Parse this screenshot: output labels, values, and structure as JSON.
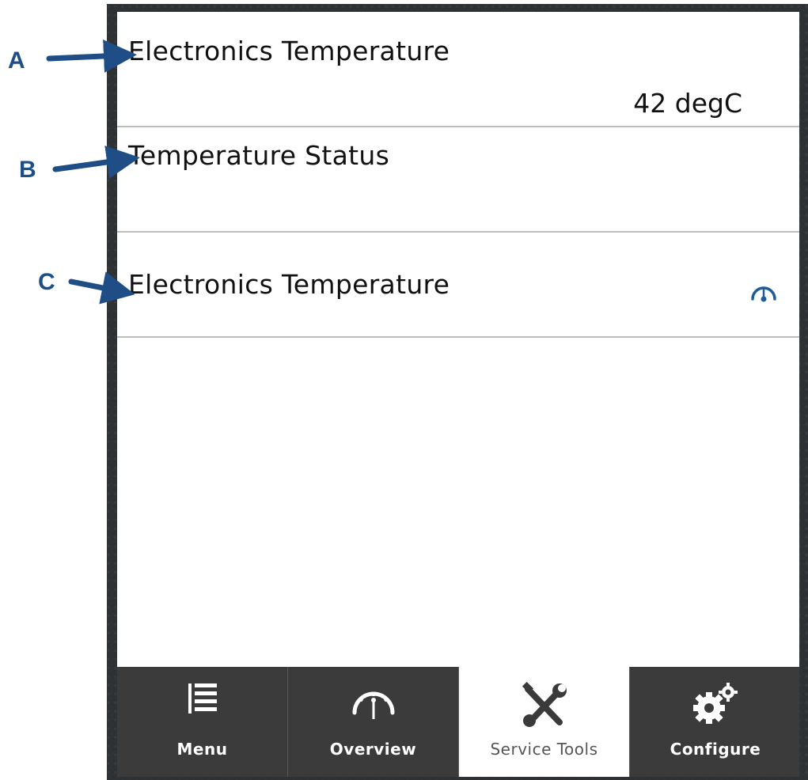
{
  "rows": [
    {
      "label": "Electronics Temperature",
      "value": "42 degC"
    },
    {
      "label": "Temperature Status"
    },
    {
      "label": "Electronics Temperature",
      "icon": "gauge-icon"
    }
  ],
  "callouts": {
    "a": "A",
    "b": "B",
    "c": "C"
  },
  "tabs": [
    {
      "label": "Menu",
      "icon": "menu-list-icon",
      "active": false
    },
    {
      "label": "Overview",
      "icon": "gauge-icon",
      "active": false
    },
    {
      "label": "Service Tools",
      "icon": "tools-icon",
      "active": true
    },
    {
      "label": "Configure",
      "icon": "gears-icon",
      "active": false
    }
  ],
  "colors": {
    "callout": "#1f4e86",
    "tabbar": "#3b3b3b",
    "gauge": "#1f5d99",
    "divider": "#bdbdbd"
  }
}
